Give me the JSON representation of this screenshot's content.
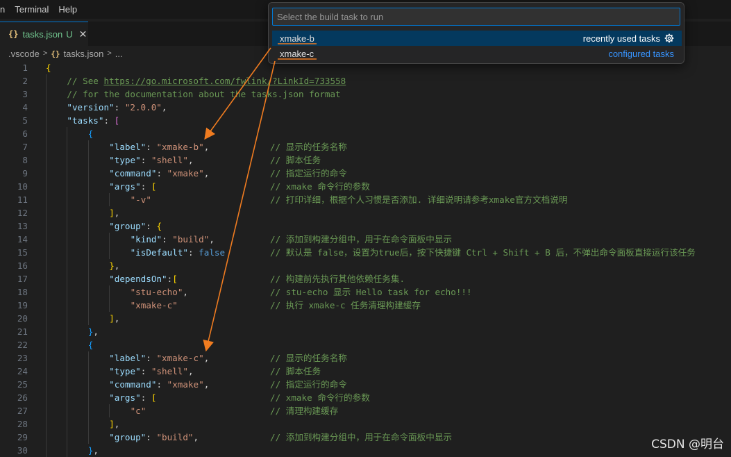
{
  "menu": [
    "n",
    "Terminal",
    "Help"
  ],
  "tab": {
    "icon": "{}",
    "name": "tasks.json",
    "modified": "U",
    "close": "✕"
  },
  "breadcrumb": {
    "folder": ".vscode",
    "icon": "{}",
    "file": "tasks.json",
    "more": "..."
  },
  "quickpick": {
    "placeholder": "Select the build task to run",
    "items": [
      {
        "label": "xmake-b",
        "description": "recently used tasks"
      },
      {
        "label": "xmake-c",
        "description": "configured tasks"
      }
    ]
  },
  "lines": [
    {
      "n": "1",
      "ind": 0,
      "h": "<span class=\"b1\">{</span>",
      "c": ""
    },
    {
      "n": "2",
      "ind": 1,
      "h": "<span class=\"c\">// See <span class=\"u\">https://go.microsoft.com/fwlink/?LinkId=733558</span></span>",
      "c": ""
    },
    {
      "n": "3",
      "ind": 1,
      "h": "<span class=\"c\">// for the documentation about the tasks.json format</span>",
      "c": ""
    },
    {
      "n": "4",
      "ind": 1,
      "h": "<span class=\"k\">\"version\"</span><span class=\"p\">: </span><span class=\"s\">\"2.0.0\"</span><span class=\"p\">,</span>",
      "c": ""
    },
    {
      "n": "5",
      "ind": 1,
      "h": "<span class=\"k\">\"tasks\"</span><span class=\"p\">: </span><span class=\"b2\">[</span>",
      "c": ""
    },
    {
      "n": "6",
      "ind": 2,
      "h": "<span class=\"b3\">{</span>",
      "c": ""
    },
    {
      "n": "7",
      "ind": 3,
      "h": "<span class=\"k\">\"label\"</span><span class=\"p\">: </span><span class=\"s\">\"xmake-b\"</span><span class=\"p\">,</span>",
      "c": "// 显示的任务名称"
    },
    {
      "n": "8",
      "ind": 3,
      "h": "<span class=\"k\">\"type\"</span><span class=\"p\">: </span><span class=\"s\">\"shell\"</span><span class=\"p\">,</span>",
      "c": "// 脚本任务"
    },
    {
      "n": "9",
      "ind": 3,
      "h": "<span class=\"k\">\"command\"</span><span class=\"p\">: </span><span class=\"s\">\"xmake\"</span><span class=\"p\">,</span>",
      "c": "// 指定运行的命令"
    },
    {
      "n": "10",
      "ind": 3,
      "h": "<span class=\"k\">\"args\"</span><span class=\"p\">: </span><span class=\"b1\">[</span>",
      "c": "// xmake 命令行的参数"
    },
    {
      "n": "11",
      "ind": 4,
      "h": "<span class=\"s\">\"-v\"</span>",
      "c": "// 打印详细，根据个人习惯是否添加. 详细说明请参考xmake官方文档说明"
    },
    {
      "n": "12",
      "ind": 3,
      "h": "<span class=\"b1\">]</span><span class=\"p\">,</span>",
      "c": ""
    },
    {
      "n": "13",
      "ind": 3,
      "h": "<span class=\"k\">\"group\"</span><span class=\"p\">: </span><span class=\"b1\">{</span>",
      "c": ""
    },
    {
      "n": "14",
      "ind": 4,
      "h": "<span class=\"k\">\"kind\"</span><span class=\"p\">: </span><span class=\"s\">\"build\"</span><span class=\"p\">,</span>",
      "c": "// 添加到构建分组中，用于在命令面板中显示"
    },
    {
      "n": "15",
      "ind": 4,
      "h": "<span class=\"k\">\"isDefault\"</span><span class=\"p\">: </span><span class=\"kw\">false</span>",
      "c": "// 默认是 false，设置为true后，按下快捷键 Ctrl + Shift + B 后，不弹出命令面板直接运行该任务"
    },
    {
      "n": "16",
      "ind": 3,
      "h": "<span class=\"b1\">}</span><span class=\"p\">,</span>",
      "c": ""
    },
    {
      "n": "17",
      "ind": 3,
      "h": "<span class=\"k\">\"dependsOn\"</span><span class=\"p\">:</span><span class=\"b1\">[</span>",
      "c": "// 构建前先执行其他依赖任务集."
    },
    {
      "n": "18",
      "ind": 4,
      "h": "<span class=\"s\">\"stu-echo\"</span><span class=\"p\">,</span>",
      "c": "// stu-echo 显示 Hello task for echo!!!"
    },
    {
      "n": "19",
      "ind": 4,
      "h": "<span class=\"s\">\"xmake-c\"</span>",
      "c": "// 执行 xmake-c 任务清理构建缓存"
    },
    {
      "n": "20",
      "ind": 3,
      "h": "<span class=\"b1\">]</span><span class=\"p\">,</span>",
      "c": ""
    },
    {
      "n": "21",
      "ind": 2,
      "h": "<span class=\"b3\">}</span><span class=\"p\">,</span>",
      "c": ""
    },
    {
      "n": "22",
      "ind": 2,
      "h": "<span class=\"b3\">{</span>",
      "c": ""
    },
    {
      "n": "23",
      "ind": 3,
      "h": "<span class=\"k\">\"label\"</span><span class=\"p\">: </span><span class=\"s\">\"xmake-c\"</span><span class=\"p\">,</span>",
      "c": "// 显示的任务名称"
    },
    {
      "n": "24",
      "ind": 3,
      "h": "<span class=\"k\">\"type\"</span><span class=\"p\">: </span><span class=\"s\">\"shell\"</span><span class=\"p\">,</span>",
      "c": "// 脚本任务"
    },
    {
      "n": "25",
      "ind": 3,
      "h": "<span class=\"k\">\"command\"</span><span class=\"p\">: </span><span class=\"s\">\"xmake\"</span><span class=\"p\">,</span>",
      "c": "// 指定运行的命令"
    },
    {
      "n": "26",
      "ind": 3,
      "h": "<span class=\"k\">\"args\"</span><span class=\"p\">: </span><span class=\"b1\">[</span>",
      "c": "// xmake 命令行的参数"
    },
    {
      "n": "27",
      "ind": 4,
      "h": "<span class=\"s\">\"c\"</span>",
      "c": "// 清理构建缓存"
    },
    {
      "n": "28",
      "ind": 3,
      "h": "<span class=\"b1\">]</span><span class=\"p\">,</span>",
      "c": ""
    },
    {
      "n": "29",
      "ind": 3,
      "h": "<span class=\"k\">\"group\"</span><span class=\"p\">: </span><span class=\"s\">\"build\"</span><span class=\"p\">,</span>",
      "c": "// 添加到构建分组中，用于在命令面板中显示"
    },
    {
      "n": "30",
      "ind": 2,
      "h": "<span class=\"b3\">}</span><span class=\"p\">,</span>",
      "c": ""
    }
  ],
  "annotation_color": "#f07c20",
  "watermark": "CSDN @明台"
}
